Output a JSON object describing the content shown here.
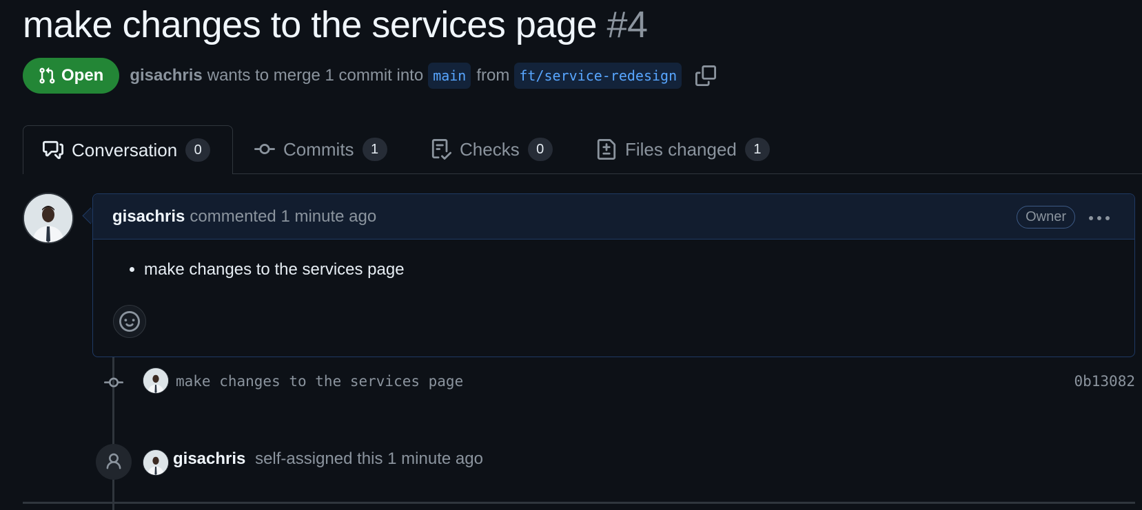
{
  "pull_request": {
    "title": "make changes to the services page",
    "number": "#4",
    "state": "Open",
    "author": "gisachris",
    "merge_text": "wants to merge 1 commit into",
    "base_branch": "main",
    "from_text": "from",
    "head_branch": "ft/service-redesign"
  },
  "tabs": [
    {
      "label": "Conversation",
      "count": "0",
      "icon": "comment-discussion-icon"
    },
    {
      "label": "Commits",
      "count": "1",
      "icon": "git-commit-icon"
    },
    {
      "label": "Checks",
      "count": "0",
      "icon": "checklist-icon"
    },
    {
      "label": "Files changed",
      "count": "1",
      "icon": "file-diff-icon"
    }
  ],
  "comment": {
    "author": "gisachris",
    "action": "commented 1 minute ago",
    "role_badge": "Owner",
    "body_items": [
      "make changes to the services page"
    ]
  },
  "commit": {
    "message": "make changes to the services page",
    "sha": "0b13082"
  },
  "event": {
    "actor": "gisachris",
    "text": "self-assigned this 1 minute ago"
  },
  "colors": {
    "background": "#0d1117",
    "open_green": "#238636",
    "branch_blue": "#58a6ff",
    "muted": "#8b949e"
  }
}
